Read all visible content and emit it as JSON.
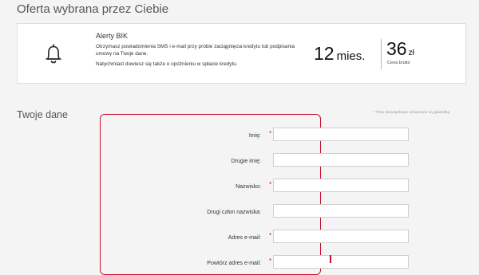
{
  "page": {
    "section_title": "Oferta wybrana przez Ciebie",
    "your_data_title": "Twoje dane",
    "required_note": "* Pola obowiązkowe oznaczone są gwiazdką"
  },
  "offer": {
    "icon": "bell-icon",
    "name": "Alerty BIK",
    "description": "Otrzymasz powiadomienia SMS i e-mail przy próbie zaciągnięcia kredytu lub podpisania umowy na Twoje dane.",
    "note": "Natychmiast dowiesz się także o opóźnieniu w spłacie kredytu.",
    "period_value": "12",
    "period_unit": "mies.",
    "price_value": "36",
    "price_unit": "zł",
    "price_label": "Cena brutto"
  },
  "form": {
    "fields": [
      {
        "label": "Imię:",
        "required": "*",
        "value": ""
      },
      {
        "label": "Drugie imię:",
        "required": "",
        "value": ""
      },
      {
        "label": "Nazwisko:",
        "required": "*",
        "value": ""
      },
      {
        "label": "Drugi człon nazwiska:",
        "required": "",
        "value": ""
      },
      {
        "label": "Adres e-mail:",
        "required": "*",
        "value": ""
      },
      {
        "label": "Powtórz adres e-mail:",
        "required": "*",
        "value": ""
      }
    ]
  },
  "colors": {
    "accent": "#c8102e",
    "background": "#f4f4f4",
    "card": "#ffffff"
  }
}
